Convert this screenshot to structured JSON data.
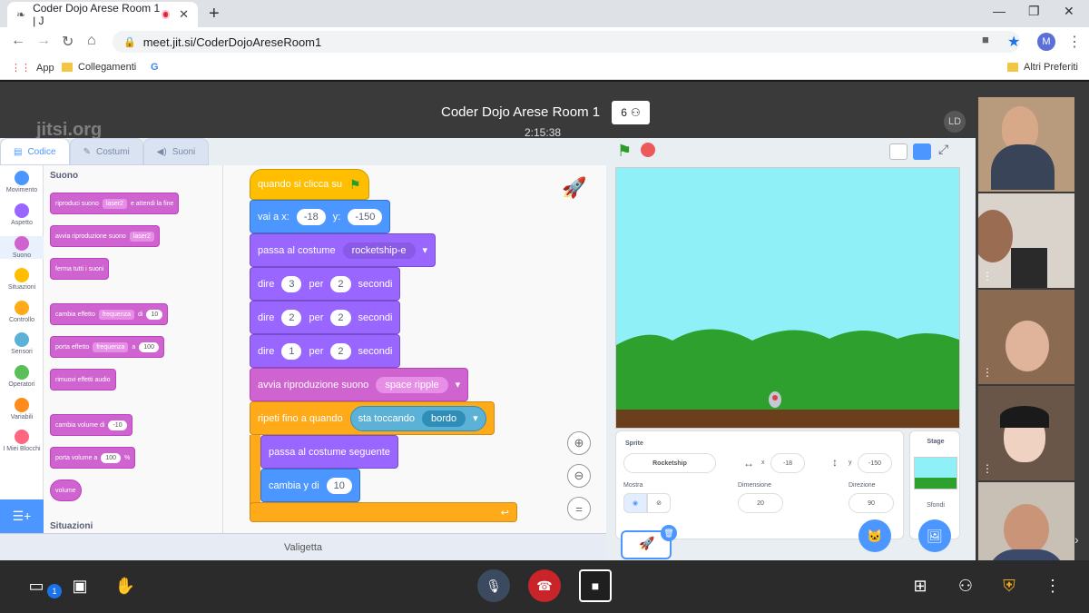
{
  "browser": {
    "tab_title": "Coder Dojo Arese Room 1 | J",
    "url": "meet.jit.si/CoderDojoAreseRoom1",
    "profile_initial": "M",
    "bookmarks": [
      "App",
      "Collegamenti",
      "G"
    ],
    "other_bookmarks": "Altri Preferiti"
  },
  "meeting": {
    "title": "Coder Dojo Arese Room 1",
    "participants": "6",
    "timer": "2:15:38",
    "logo": "jitsi.org",
    "initials": "LD",
    "chat_badge": "1"
  },
  "scratch": {
    "tabs": [
      "Codice",
      "Costumi",
      "Suoni"
    ],
    "categories": [
      {
        "label": "Movimento",
        "color": "#4c97ff"
      },
      {
        "label": "Aspetto",
        "color": "#9966ff"
      },
      {
        "label": "Suono",
        "color": "#cf63cf"
      },
      {
        "label": "Situazioni",
        "color": "#ffbf00"
      },
      {
        "label": "Controllo",
        "color": "#ffab19"
      },
      {
        "label": "Sensori",
        "color": "#5cb1d6"
      },
      {
        "label": "Operatori",
        "color": "#59c059"
      },
      {
        "label": "Variabili",
        "color": "#ff8c1a"
      },
      {
        "label": "I Miei Blocchi",
        "color": "#ff6680"
      }
    ],
    "palette_title": "Suono",
    "palette_blocks": {
      "b1_text": "riproduci suono",
      "b1_dd": "laser2",
      "b1_end": "e attendi la fine",
      "b2_text": "avvia riproduzione suono",
      "b2_dd": "laser2",
      "b3_text": "ferma tutti i suoni",
      "b4_text": "cambia effetto",
      "b4_dd": "frequenza",
      "b4_mid": "di",
      "b4_val": "10",
      "b5_text": "porta effetto",
      "b5_dd": "frequenza",
      "b5_mid": "a",
      "b5_val": "100",
      "b6_text": "rimuovi effetti audio",
      "b7_text": "cambia volume di",
      "b7_val": "-10",
      "b8_text": "porta volume a",
      "b8_val": "100",
      "b8_end": "%",
      "b9_text": "volume"
    },
    "palette_next_title": "Situazioni",
    "script": {
      "hat": "quando si clicca su",
      "goto_label": "vai a x:",
      "goto_x": "-18",
      "goto_y_label": "y:",
      "goto_y": "-150",
      "costume_label": "passa al costume",
      "costume_value": "rocketship-e",
      "say_label": "dire",
      "say_per": "per",
      "say_seconds": "secondi",
      "say1": "3",
      "say1_t": "2",
      "say2": "2",
      "say2_t": "2",
      "say3": "1",
      "say3_t": "2",
      "sound_label": "avvia riproduzione suono",
      "sound_value": "space ripple",
      "repeat_label": "ripeti fino a quando",
      "touching_label": "sta toccando",
      "touching_value": "bordo",
      "next_costume": "passa al costume seguente",
      "change_y": "cambia y di",
      "change_y_val": "10"
    },
    "backpack": "Valigetta",
    "sprite_panel": {
      "sprite_label": "Sprite",
      "sprite_name": "Rocketship",
      "x_label": "x",
      "x_value": "-18",
      "y_label": "y",
      "y_value": "-150",
      "show_label": "Mostra",
      "size_label": "Dimensione",
      "size_value": "20",
      "direction_label": "Direzione",
      "direction_value": "90"
    },
    "stage_panel": {
      "title": "Stage",
      "backdrops_label": "Sfondi"
    }
  },
  "colors": {
    "sky": "#8ff0f7",
    "hills": "#2ea02e",
    "ground": "#6b3f1c"
  }
}
